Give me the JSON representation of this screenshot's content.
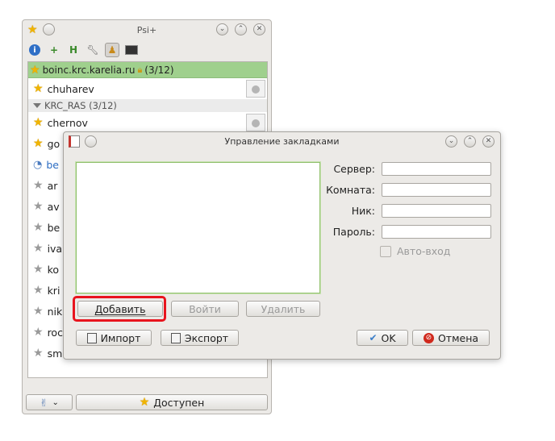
{
  "psi": {
    "title": "Psi+",
    "account": {
      "name": "boinc.krc.karelia.ru",
      "count": "(3/12)"
    },
    "contacts_top": [
      {
        "name": "chuharev"
      }
    ],
    "group": {
      "name": "KRC_RAS (3/12)"
    },
    "contacts_group": [
      {
        "name": "chernov",
        "status": "online",
        "avatar": true
      },
      {
        "name": "go",
        "status": "online"
      },
      {
        "name": "be",
        "status": "away"
      },
      {
        "name": "ar",
        "status": "offline"
      },
      {
        "name": "av",
        "status": "offline"
      },
      {
        "name": "be",
        "status": "offline"
      },
      {
        "name": "iva",
        "status": "offline"
      },
      {
        "name": "ko",
        "status": "offline"
      },
      {
        "name": "kri",
        "status": "offline"
      },
      {
        "name": "nik",
        "status": "offline"
      },
      {
        "name": "roc",
        "status": "offline"
      },
      {
        "name": "sm",
        "status": "offline"
      }
    ],
    "status_button": "Доступен"
  },
  "dialog": {
    "title": "Управление закладками",
    "fields": {
      "server_label": "Сервер:",
      "room_label": "Комната:",
      "nick_label": "Ник:",
      "password_label": "Пароль:",
      "autologin_label": "Авто-вход"
    },
    "buttons": {
      "add": "Добавить",
      "join": "Войти",
      "delete": "Удалить",
      "import": "Импорт",
      "export": "Экспорт",
      "ok": "OK",
      "cancel": "Отмена"
    }
  }
}
